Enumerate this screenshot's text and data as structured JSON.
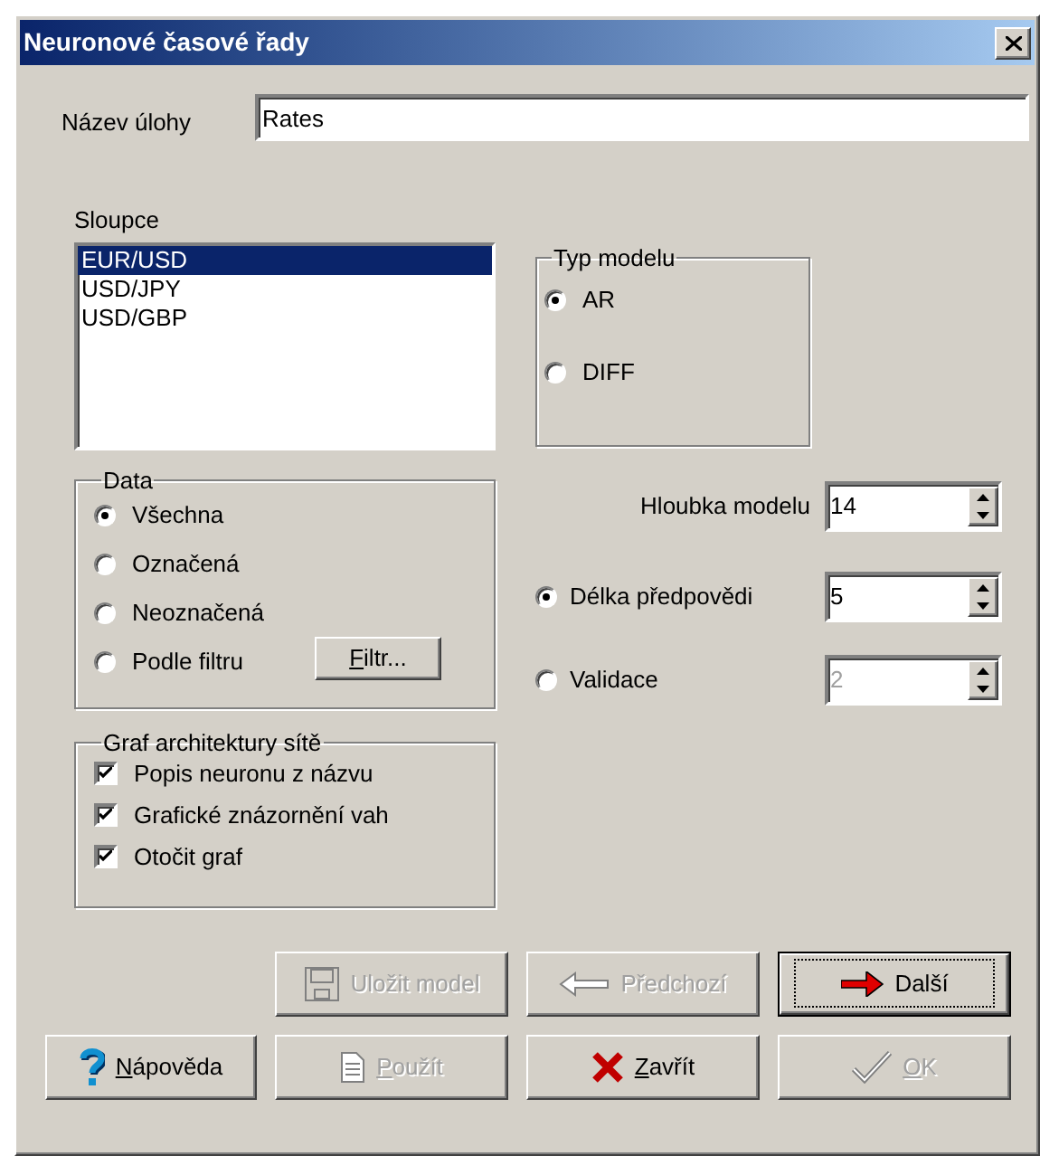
{
  "window": {
    "title": "Neuronové časové řady"
  },
  "task_name": {
    "label": "Název úlohy",
    "value": "Rates"
  },
  "columns": {
    "label": "Sloupce",
    "items": [
      {
        "label": "EUR/USD",
        "selected": true
      },
      {
        "label": "USD/JPY",
        "selected": false
      },
      {
        "label": "USD/GBP",
        "selected": false
      }
    ]
  },
  "model_type": {
    "title": "Typ modelu",
    "options": [
      {
        "label": "AR",
        "selected": true
      },
      {
        "label": "DIFF",
        "selected": false
      }
    ]
  },
  "data": {
    "title": "Data",
    "options": [
      {
        "label": "Všechna",
        "selected": true
      },
      {
        "label": "Označená",
        "selected": false
      },
      {
        "label": "Neoznačená",
        "selected": false
      },
      {
        "label": "Podle filtru",
        "selected": false
      }
    ],
    "filter_button": {
      "label": "Filtr...",
      "mnemonic": true
    }
  },
  "model_depth": {
    "label": "Hloubka modelu",
    "value": "14",
    "disabled": false
  },
  "forecast_length": {
    "label": "Délka předpovědi",
    "value": "5",
    "selected": true,
    "disabled": false
  },
  "validation": {
    "label": "Validace",
    "value": "2",
    "selected": false,
    "disabled": true
  },
  "network_graph": {
    "title": "Graf architektury sítě",
    "options": [
      {
        "label": "Popis neuronu z názvu",
        "checked": true
      },
      {
        "label": "Grafické znázornění vah",
        "checked": true
      },
      {
        "label": "Otočit graf",
        "checked": true
      }
    ]
  },
  "button_rows": [
    [
      {
        "kind": "save",
        "label": "Uložit model",
        "disabled": true,
        "default": false,
        "mnemonic": false
      },
      {
        "kind": "previous",
        "label": "Předchozí",
        "disabled": true,
        "default": false,
        "mnemonic": false
      },
      {
        "kind": "next",
        "label": "Další",
        "disabled": false,
        "default": true,
        "mnemonic": false
      }
    ],
    [
      {
        "kind": "help",
        "label": "Nápověda",
        "disabled": false,
        "default": false,
        "mnemonic": true
      },
      {
        "kind": "apply",
        "label": "Použít",
        "disabled": true,
        "default": false,
        "mnemonic": true
      },
      {
        "kind": "close",
        "label": "Zavřít",
        "disabled": false,
        "default": false,
        "mnemonic": true
      },
      {
        "kind": "ok",
        "label": "OK",
        "disabled": true,
        "default": false,
        "mnemonic": true
      }
    ]
  ]
}
